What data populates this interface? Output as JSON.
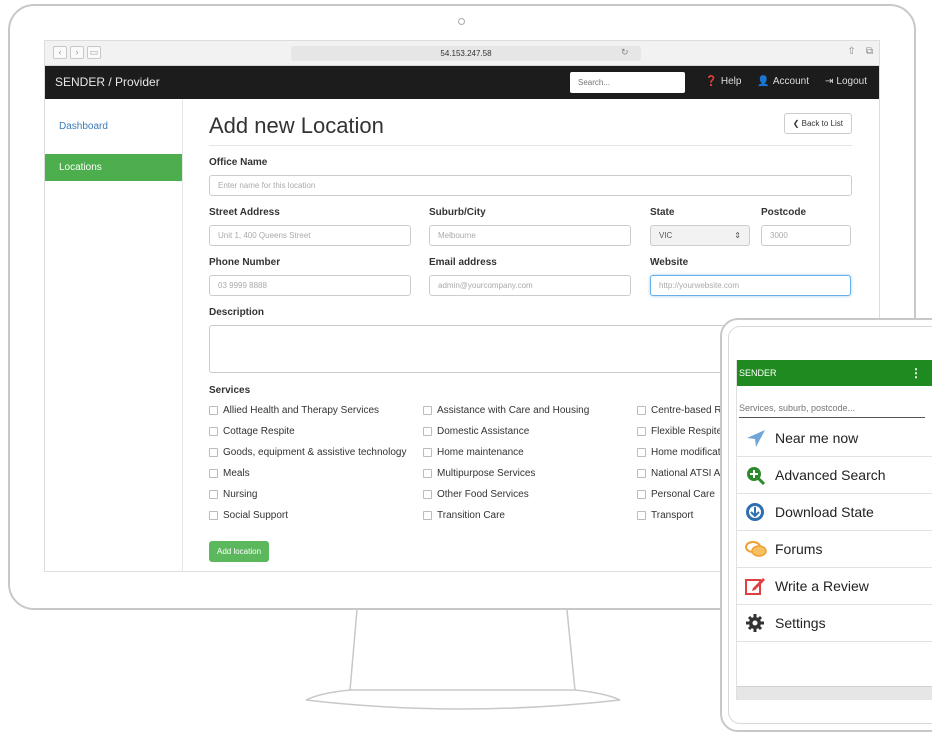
{
  "browser": {
    "address": "54.153.247.58"
  },
  "topnav": {
    "brand": "SENDER / Provider",
    "search_placeholder": "Search...",
    "help": "Help",
    "account": "Account",
    "logout": "Logout"
  },
  "sidebar": {
    "items": [
      {
        "label": "Dashboard"
      },
      {
        "label": "Locations"
      }
    ]
  },
  "form": {
    "title": "Add new Location",
    "back_label": "Back to List",
    "office_name": {
      "label": "Office Name",
      "placeholder": "Enter name for this location"
    },
    "street": {
      "label": "Street Address",
      "placeholder": "Unit 1, 400 Queens Street"
    },
    "suburb": {
      "label": "Suburb/City",
      "placeholder": "Melbourne"
    },
    "state": {
      "label": "State",
      "value": "VIC"
    },
    "postcode": {
      "label": "Postcode",
      "placeholder": "3000"
    },
    "phone": {
      "label": "Phone Number",
      "placeholder": "03 9999 8888"
    },
    "email": {
      "label": "Email address",
      "placeholder": "admin@yourcompany.com"
    },
    "website": {
      "label": "Website",
      "placeholder": "http://yourwebsite.com"
    },
    "description": {
      "label": "Description"
    },
    "services_label": "Services",
    "services": [
      [
        "Allied Health and Therapy Services",
        "Assistance with Care and Housing",
        "Centre-based Re"
      ],
      [
        "Cottage Respite",
        "Domestic Assistance",
        "Flexible Respite"
      ],
      [
        "Goods, equipment & assistive technology",
        "Home maintenance",
        "Home modificatio"
      ],
      [
        "Meals",
        "Multipurpose Services",
        "National ATSI Ag"
      ],
      [
        "Nursing",
        "Other Food Services",
        "Personal Care"
      ],
      [
        "Social Support",
        "Transition Care",
        "Transport"
      ]
    ],
    "submit_label": "Add location"
  },
  "phone": {
    "brand": "SENDER",
    "search_placeholder": "Services, suburb, postcode...",
    "menu": [
      {
        "label": "Near me now",
        "icon": "navigation-arrow-icon"
      },
      {
        "label": "Advanced Search",
        "icon": "search-plus-icon"
      },
      {
        "label": "Download State",
        "icon": "download-icon"
      },
      {
        "label": "Forums",
        "icon": "chat-bubbles-icon"
      },
      {
        "label": "Write a Review",
        "icon": "edit-icon"
      },
      {
        "label": "Settings",
        "icon": "gear-icon"
      }
    ],
    "colors": {
      "header": "#1f8a1f"
    }
  },
  "colors": {
    "nav_bg": "#1c1c1c",
    "active_sidebar": "#4cae4c",
    "primary_button": "#5cb85c",
    "link": "#3c7ab8"
  }
}
